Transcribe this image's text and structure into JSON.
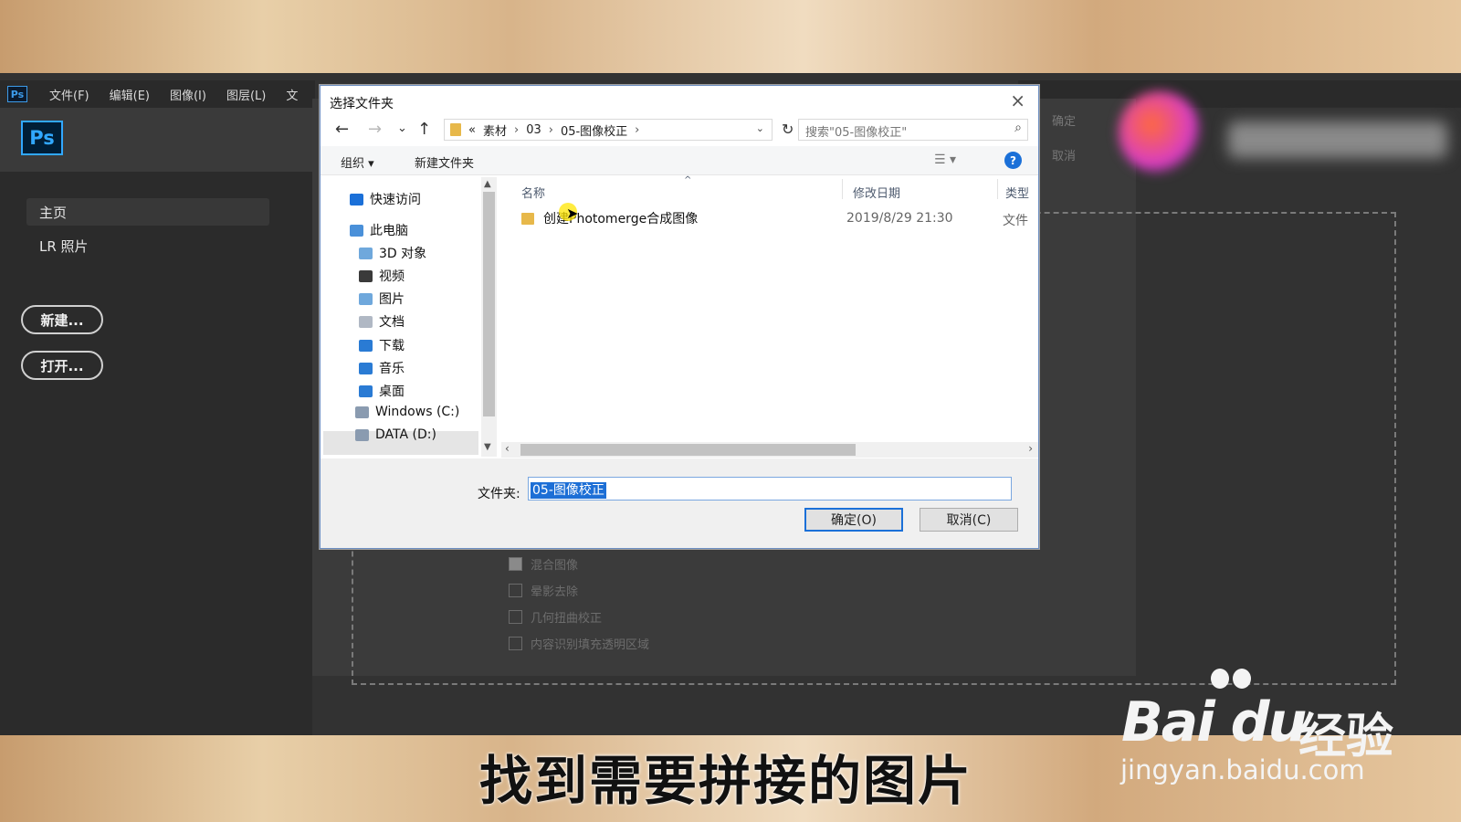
{
  "photoshop": {
    "small_logo": "Ps",
    "menu": [
      "文件(F)",
      "编辑(E)",
      "图像(I)",
      "图层(L)",
      "文"
    ],
    "big_logo": "Ps",
    "nav_home": "主页",
    "nav_lr": "LR 照片",
    "new_button": "新建...",
    "open_button": "打开..."
  },
  "photomerge": {
    "ok": "确定",
    "cancel": "取消",
    "options": [
      {
        "label": "混合图像",
        "checked": true
      },
      {
        "label": "晕影去除",
        "checked": false
      },
      {
        "label": "几何扭曲校正",
        "checked": false
      },
      {
        "label": "内容识别填充透明区域",
        "checked": false
      }
    ]
  },
  "dialog": {
    "title": "选择文件夹",
    "close": "×",
    "nav": {
      "back": "←",
      "forward": "→",
      "recent": "⌄",
      "up": "↑",
      "refresh": "↻"
    },
    "breadcrumb": [
      "«",
      "素材",
      "03",
      "05-图像校正"
    ],
    "search_placeholder": "搜索\"05-图像校正\"",
    "toolbar": {
      "organize": "组织 ▾",
      "new_folder": "新建文件夹",
      "help": "?"
    },
    "nav_pane": [
      {
        "label": "快速访问",
        "icon": "star-icon",
        "color": "#1b70d8"
      },
      {
        "label": "此电脑",
        "icon": "computer-icon",
        "color": "#4a90d9"
      },
      {
        "label": "3D 对象",
        "icon": "3d-objects-icon",
        "color": "#6fa8dc"
      },
      {
        "label": "视频",
        "icon": "video-icon",
        "color": "#3a3a3a"
      },
      {
        "label": "图片",
        "icon": "pictures-icon",
        "color": "#6fa8dc"
      },
      {
        "label": "文档",
        "icon": "documents-icon",
        "color": "#b0b8c4"
      },
      {
        "label": "下载",
        "icon": "downloads-icon",
        "color": "#2a7bd4"
      },
      {
        "label": "音乐",
        "icon": "music-icon",
        "color": "#2a7bd4"
      },
      {
        "label": "桌面",
        "icon": "desktop-icon",
        "color": "#2a7bd4"
      },
      {
        "label": "Windows (C:)",
        "icon": "drive-c-icon",
        "color": "#8a9bb0"
      },
      {
        "label": "DATA (D:)",
        "icon": "drive-d-icon",
        "color": "#8a9bb0"
      }
    ],
    "columns": {
      "name": "名称",
      "date": "修改日期",
      "type": "类型"
    },
    "files": [
      {
        "name": "创建Photomerge合成图像",
        "date": "2019/8/29 21:30",
        "type": "文件"
      }
    ],
    "folder_label": "文件夹:",
    "folder_value": "05-图像校正",
    "ok_button": "确定(O)",
    "cancel_button": "取消(C)"
  },
  "overlay": {
    "subtitle": "找到需要拼接的图片",
    "watermark_main": "Bai du",
    "watermark_jingyan": "经验",
    "watermark_url": "jingyan.baidu.com"
  }
}
